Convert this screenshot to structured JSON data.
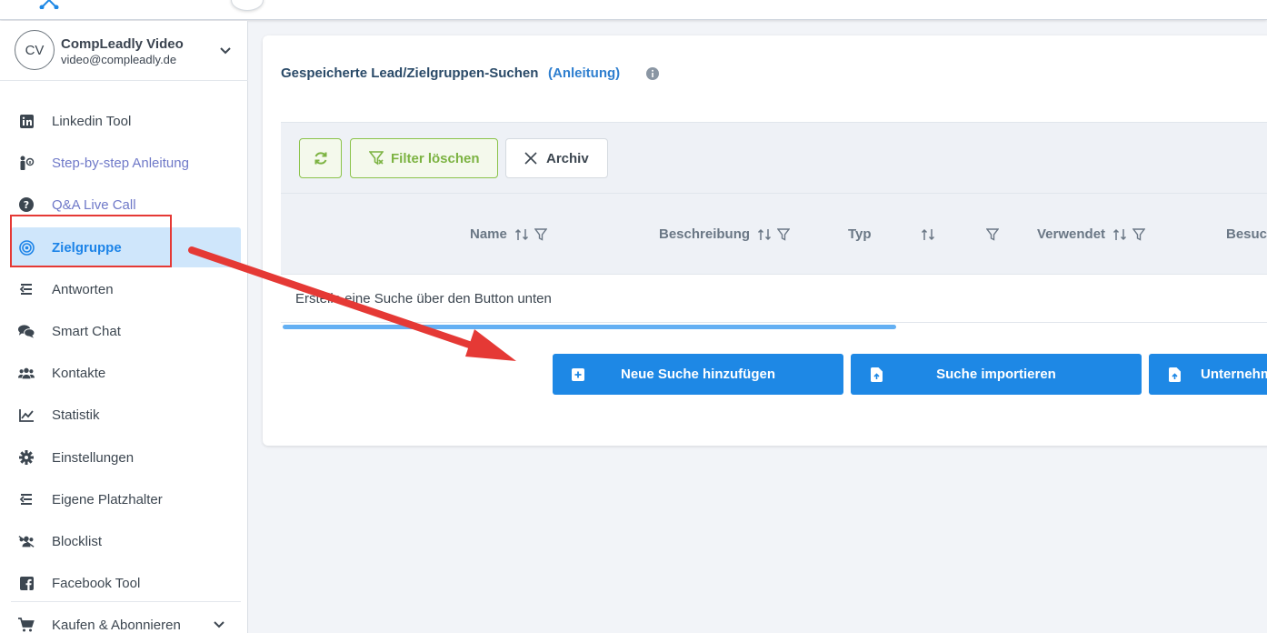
{
  "user": {
    "initials": "CV",
    "name": "CompLeadly Video",
    "email": "video@compleadly.de"
  },
  "sidebar": {
    "items": [
      {
        "label": "Linkedin Tool",
        "icon": "linkedin-icon"
      },
      {
        "label": "Step-by-step Anleitung",
        "icon": "person-guide-icon"
      },
      {
        "label": "Q&A Live Call",
        "icon": "question-circle-icon"
      },
      {
        "label": "Zielgruppe",
        "icon": "target-icon"
      },
      {
        "label": "Antworten",
        "icon": "reply-icon"
      },
      {
        "label": "Smart Chat",
        "icon": "chat-icon"
      },
      {
        "label": "Kontakte",
        "icon": "users-icon"
      },
      {
        "label": "Statistik",
        "icon": "chart-line-icon"
      },
      {
        "label": "Einstellungen",
        "icon": "gear-icon"
      },
      {
        "label": "Eigene Platzhalter",
        "icon": "placeholder-icon"
      },
      {
        "label": "Blocklist",
        "icon": "user-block-icon"
      },
      {
        "label": "Facebook Tool",
        "icon": "facebook-icon"
      },
      {
        "label": "Kaufen & Abonnieren",
        "icon": "cart-icon"
      }
    ],
    "active": "Zielgruppe"
  },
  "main": {
    "title": "Gespeicherte Lead/Zielgruppen-Suchen",
    "guide_link": "(Anleitung)",
    "toolbar": {
      "filter_clear": "Filter löschen",
      "archive": "Archiv"
    },
    "columns": [
      "Name",
      "Beschreibung",
      "Typ",
      "Verwendet",
      "Besuch"
    ],
    "empty_text": "Erstelle eine Suche über den Button unten",
    "actions": [
      "Neue Suche hinzufügen",
      "Suche importieren",
      "Unternehm"
    ]
  },
  "colors": {
    "primary": "#1e88e5",
    "accent_green": "#8bc34a",
    "annotation_red": "#e53935",
    "active_bg": "#cfe6fb"
  }
}
